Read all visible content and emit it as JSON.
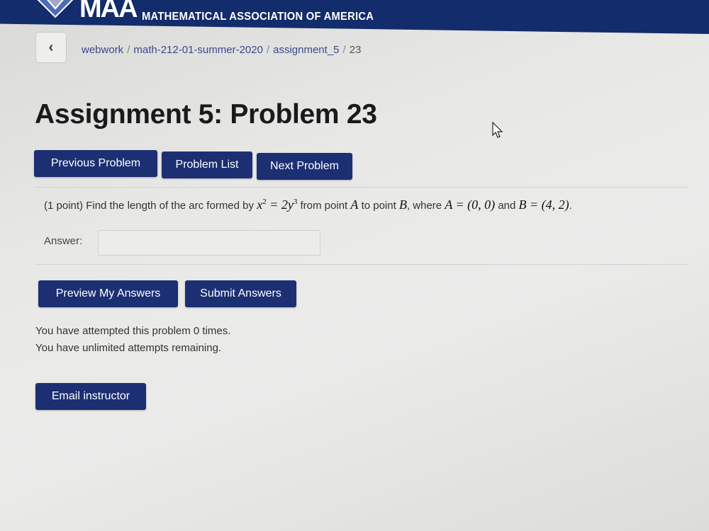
{
  "brand": {
    "logo_text": "MAA",
    "org_name": "MATHEMATICAL ASSOCIATION OF AMERICA",
    "header_color": "#132c6b"
  },
  "breadcrumb": {
    "back_icon": "chevron-left-icon",
    "items": [
      "webwork",
      "math-212-01-summer-2020",
      "assignment_5",
      "23"
    ]
  },
  "page": {
    "title": "Assignment 5: Problem 23"
  },
  "nav_buttons": {
    "previous": "Previous Problem",
    "list": "Problem List",
    "next": "Next Problem"
  },
  "problem": {
    "points": "(1 point)",
    "text_1": "Find the length of the arc formed by",
    "eq_lhs": "x",
    "eq_lhs_exp": "2",
    "eq_mid": " = 2",
    "eq_rhs": "y",
    "eq_rhs_exp": "3",
    "text_2": "from point",
    "point_a": "A",
    "text_3": "to point",
    "point_b": "B",
    "text_4": ", where",
    "a_eq": "A = (0, 0)",
    "text_5": "and",
    "b_eq": "B = (4, 2)",
    "text_6": "."
  },
  "answer": {
    "label": "Answer:",
    "value": ""
  },
  "action_buttons": {
    "preview": "Preview My Answers",
    "submit": "Submit Answers"
  },
  "attempts": {
    "line_1": "You have attempted this problem 0 times.",
    "line_2": "You have unlimited attempts remaining."
  },
  "email_button": "Email instructor",
  "button_color": "#1c2f73"
}
